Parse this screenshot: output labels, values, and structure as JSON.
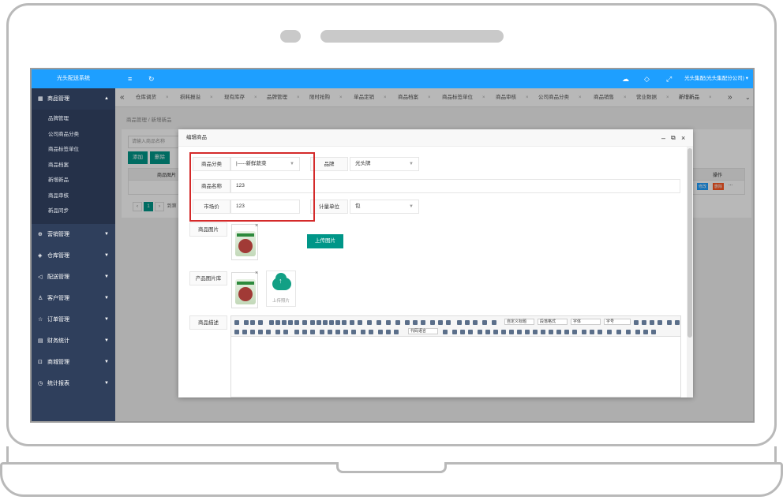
{
  "app": {
    "title": "光头配送系统",
    "user": "光头集配(光头集配分公司)"
  },
  "sidebar": {
    "groups": [
      {
        "label": "商品管理",
        "icon": "grid-icon",
        "expanded": true,
        "items": [
          "品牌管理",
          "公司商品分类",
          "商品标签单位",
          "商品档案",
          "新增新品",
          "商品审核",
          "新品同步"
        ]
      },
      {
        "label": "营销管理",
        "icon": "gift-icon"
      },
      {
        "label": "仓库管理",
        "icon": "layers-icon"
      },
      {
        "label": "配送管理",
        "icon": "send-icon"
      },
      {
        "label": "客户管理",
        "icon": "user-icon"
      },
      {
        "label": "订单管理",
        "icon": "star-icon"
      },
      {
        "label": "财务统计",
        "icon": "database-icon"
      },
      {
        "label": "商城管理",
        "icon": "cart-icon"
      },
      {
        "label": "统计报表",
        "icon": "clock-icon"
      }
    ]
  },
  "tabs": [
    "仓库调货",
    "损耗报溢",
    "现有库存",
    "品牌管理",
    "限时抢购",
    "单品定销",
    "商品档案",
    "商品标签单位",
    "商品审核",
    "公司商品分类",
    "商品销售",
    "营业数据",
    "新增新品"
  ],
  "breadcrumb": {
    "parent": "商品管理",
    "sep": "/",
    "current": "新增新品"
  },
  "list": {
    "search_placeholder": "请输入商品名称",
    "add_label": "添加",
    "delete_label": "删除",
    "col_image": "商品图片",
    "col_action": "操作",
    "edit_label": "修改",
    "del_row_label": "删除",
    "more_label": "...",
    "page_current": "1",
    "goto_text": "到第"
  },
  "modal": {
    "title": "编辑商品",
    "category_label": "商品分类",
    "category_value": "|-----新鲜蔬菜",
    "brand_label": "品牌",
    "brand_value": "光头牌",
    "name_label": "商品名称",
    "name_value": "123",
    "price_label": "市场价",
    "price_value": "123",
    "unit_label": "计量单位",
    "unit_value": "包",
    "image_label": "商品图片",
    "upload_image_btn": "上传图片",
    "gallery_label": "产品图片库",
    "upload_tile_label": "上传照片",
    "desc_label": "商品描述",
    "editor_selects": [
      "自定义标题",
      "段落格式",
      "字体",
      "字号",
      "代码语言"
    ]
  },
  "colors": {
    "topbar": "#1e9fff",
    "sidebar": "#2f3f5c",
    "accent": "#009688",
    "highlight": "#d42a2a"
  }
}
